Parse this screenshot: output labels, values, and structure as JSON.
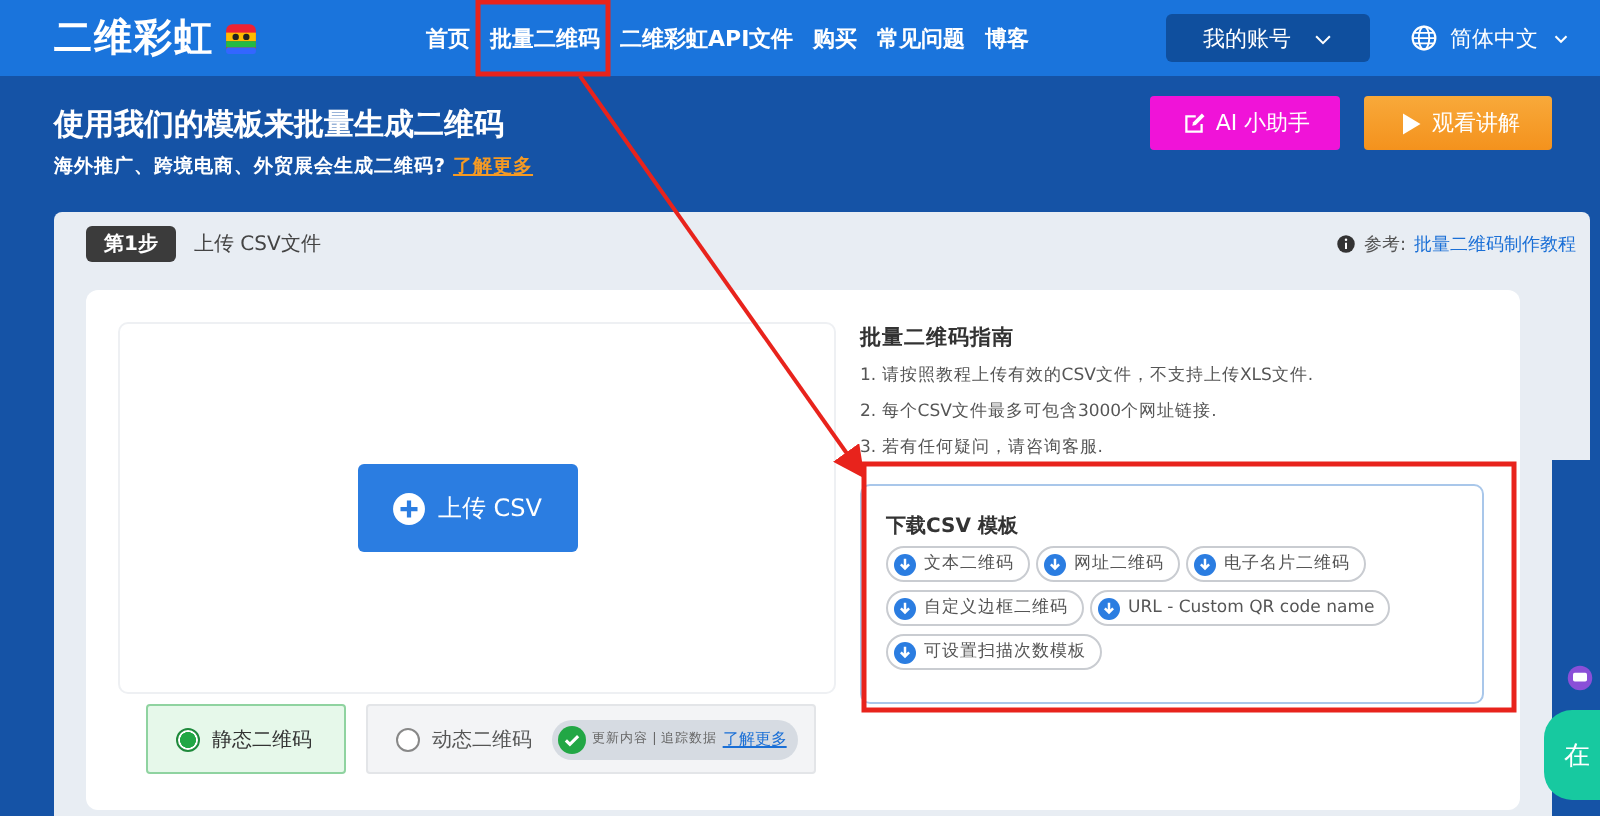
{
  "header": {
    "logo": "二维彩虹",
    "nav": [
      "首页",
      "批量二维码",
      "二维彩虹API文件",
      "购买",
      "常见问题",
      "博客"
    ],
    "account": "我的账号",
    "language": "简体中文"
  },
  "hero": {
    "title": "使用我们的模板来批量生成二维码",
    "subtitle": "海外推广、跨境电商、外贸展会生成二维码?",
    "subtitle_link": "了解更多",
    "buttons": [
      {
        "kind": "assistant",
        "label": "AI 小助手"
      },
      {
        "kind": "video",
        "label": "观看讲解"
      }
    ]
  },
  "step": {
    "badge": "第1步",
    "title": "上传 CSV文件",
    "ref_label": "参考:",
    "ref_link": "批量二维码制作教程"
  },
  "upload": {
    "button": "上传 CSV"
  },
  "code_types": [
    {
      "label": "静态二维码",
      "selected": true
    },
    {
      "label": "动态二维码",
      "selected": false,
      "features": "更新内容 | 追踪数据",
      "link": "了解更多"
    }
  ],
  "guide": {
    "title": "批量二维码指南",
    "items": [
      "1. 请按照教程上传有效的CSV文件，不支持上传XLS文件.",
      "2. 每个CSV文件最多可包含3000个网址链接.",
      "3. 若有任何疑问，请咨询客服."
    ]
  },
  "templates": {
    "title": "下载CSV 模板",
    "items": [
      "文本二维码",
      "网址二维码",
      "电子名片二维码",
      "自定义边框二维码",
      "URL - Custom QR code name",
      "可设置扫描次数模板"
    ]
  },
  "chat": {
    "label": "在"
  }
}
